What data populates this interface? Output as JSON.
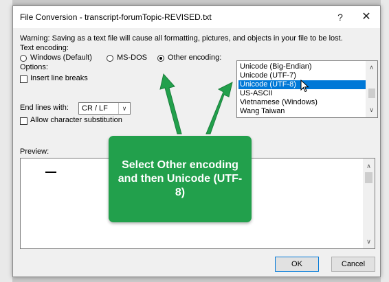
{
  "dialog": {
    "title": "File Conversion - transcript-forumTopic-REVISED.txt",
    "help": "?",
    "close": "✕",
    "warning": "Warning: Saving as a text file will cause all formatting, pictures, and objects in your file to be lost.",
    "text_encoding_label": "Text encoding:",
    "radio_windows": "Windows (Default)",
    "radio_msdos": "MS-DOS",
    "radio_other": "Other encoding:",
    "options_label": "Options:",
    "insert_line_breaks": "Insert line breaks",
    "end_lines_label": "End lines with:",
    "end_lines_value": "CR / LF",
    "allow_substitution": "Allow character substitution",
    "preview_label": "Preview:",
    "ok": "OK",
    "cancel": "Cancel"
  },
  "encodings": {
    "items": [
      "Unicode (Big-Endian)",
      "Unicode (UTF-7)",
      "Unicode (UTF-8)",
      "US-ASCII",
      "Vietnamese (Windows)",
      "Wang Taiwan"
    ],
    "selected": "Unicode (UTF-8)"
  },
  "callout": {
    "text": "Select Other encoding and then Unicode (UTF-8)"
  },
  "colors": {
    "callout_green": "#22a04c",
    "selection_blue": "#0078d7"
  }
}
